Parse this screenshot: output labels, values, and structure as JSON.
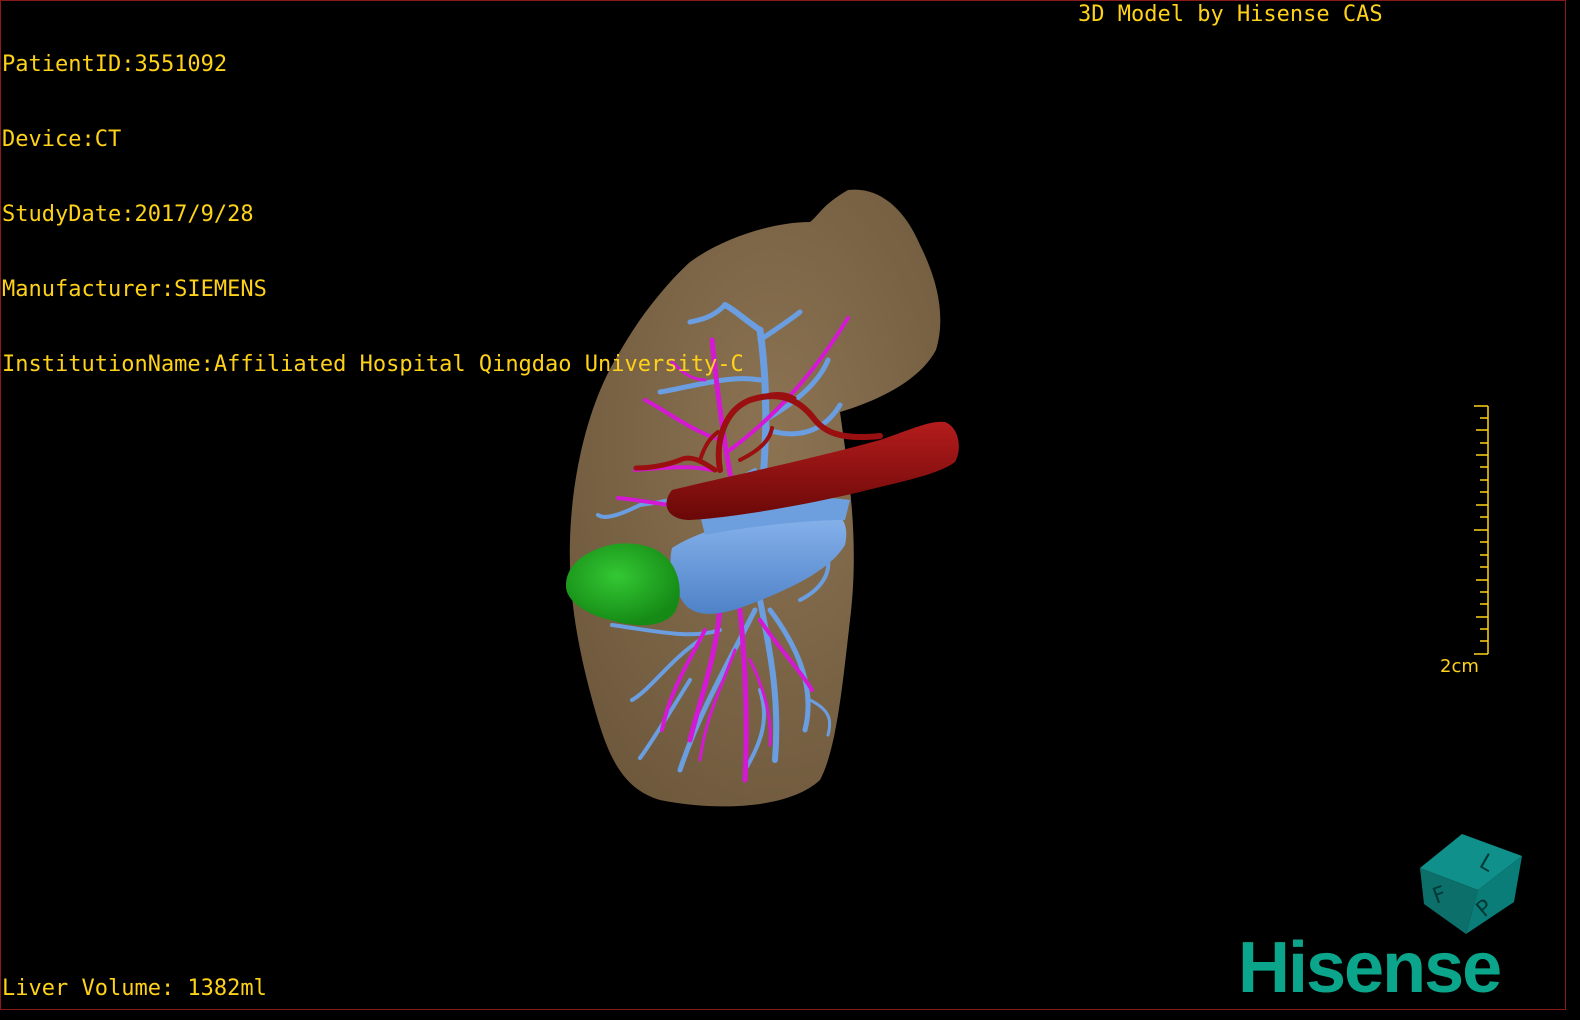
{
  "overlay": {
    "patient_id": "PatientID:3551092",
    "device": "Device:CT",
    "study_date": "StudyDate:2017/9/28",
    "manufacturer": "Manufacturer:SIEMENS",
    "institution": "InstitutionName:Affiliated Hospital Qingdao University-C"
  },
  "header_right": "3D Model by Hisense CAS",
  "liver_volume": "Liver Volume: 1382ml",
  "scale_bar": {
    "label": "2cm"
  },
  "orientation_cube": {
    "faces": [
      "F",
      "L",
      "P"
    ]
  },
  "brand_logo": "Hisense",
  "colors": {
    "text": "#ffd21a",
    "liver": "#7d6446",
    "portal_vein": "#6b9ee0",
    "hepatic_vein": "#d418d4",
    "artery": "#8c0c0c",
    "lesion": "#1fa51f",
    "logo": "#0aa58a",
    "cube": "#0f7f7a"
  }
}
